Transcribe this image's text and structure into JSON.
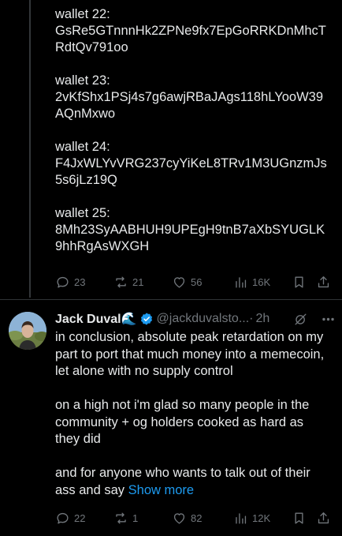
{
  "thread": {
    "wallets": [
      {
        "label": "wallet 22:",
        "address": "GsRe5GTnnnHk2ZPNe9fx7EpGoRRKDnMhcTRdtQv791oo"
      },
      {
        "label": "wallet 23:",
        "address": "2vKfShx1PSj4s7g6awjRBaJAgs118hLYooW39AQnMxwo"
      },
      {
        "label": "wallet 24:",
        "address": "F4JxWLYvVRG237cyYiKeL8TRv1M3UGnzmJs5s6jLz19Q"
      },
      {
        "label": "wallet 25:",
        "address": "8Mh23SyAABHUH9UPEgH9tnB7aXbSYUGLK9hhRgAsWXGH"
      }
    ],
    "actions": {
      "replies": "23",
      "reposts": "21",
      "likes": "56",
      "views": "16K"
    }
  },
  "reply": {
    "name": "Jack Duval🌊",
    "handle": "@jackduvalsto...",
    "separator": "·",
    "time": "2h",
    "paragraphs": [
      "in conclusion, absolute peak retardation on my part to port that much money into a memecoin, let alone with no supply control",
      "on a high not i'm glad so many people in the community + og holders cooked as hard as they did"
    ],
    "last_paragraph": "and for anyone who wants to talk out of their ass and say",
    "show_more": "Show more",
    "actions": {
      "replies": "22",
      "reposts": "1",
      "likes": "82",
      "views": "12K"
    }
  },
  "colors": {
    "background": "#000000",
    "text": "#e7e9ea",
    "muted": "#71767b",
    "accent": "#1d9bf0",
    "verified": "#1d9bf0",
    "divider": "#2f3336"
  },
  "icons": [
    "reply-icon",
    "repost-icon",
    "like-icon",
    "views-icon",
    "bookmark-icon",
    "share-icon",
    "verified-icon",
    "grok-icon",
    "more-icon"
  ]
}
